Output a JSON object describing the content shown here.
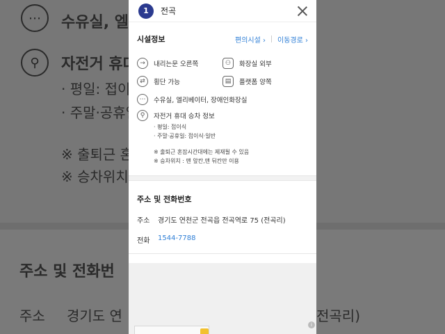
{
  "background": {
    "row1": "수유실, 엘",
    "row2": "자전거 휴대",
    "row3": "· 평일: 접이",
    "row4": "· 주말·공휴일",
    "row5": "※ 출퇴근 혼",
    "row6": "※ 승차위치",
    "row7": "주소 및 전화번",
    "row8_label": "주소",
    "row8_value": "경기도 연",
    "row8_tail": "전곡리)"
  },
  "header": {
    "badge": "1",
    "station_name": "전곡"
  },
  "facility": {
    "title": "시설정보",
    "link1": "편의시설 ›",
    "link2": "이동경로 ›",
    "items": [
      {
        "label": "내리는문 오른쪽",
        "icon": "→"
      },
      {
        "label": "화장실 외부",
        "icon": "⚇"
      },
      {
        "label": "횡단 가능",
        "icon": "⇄"
      },
      {
        "label": "플랫폼 양쪽",
        "icon": "▤"
      },
      {
        "label": "수유실, 엘리베이터, 장애인화장실",
        "icon": "⋯"
      }
    ],
    "bike": {
      "title": "자전거 휴대 승차 정보",
      "line1": "· 평일: 접이식",
      "line2": "· 주말·공휴일: 접이식·일반",
      "note1": "※ 출퇴근 혼잡시간대에는 제재될 수 있음",
      "note2": "※ 승차위치 : 맨 앞칸,맨 뒤칸만 이용"
    }
  },
  "contact": {
    "title": "주소 및 전화번호",
    "address_label": "주소",
    "address_value": "경기도 연천군 전곡읍 전곡역로 75 (전곡리)",
    "phone_label": "전화",
    "phone_value": "1544-7788"
  },
  "colors": {
    "accent": "#2f7fd6",
    "badge": "#2b3a8f"
  }
}
